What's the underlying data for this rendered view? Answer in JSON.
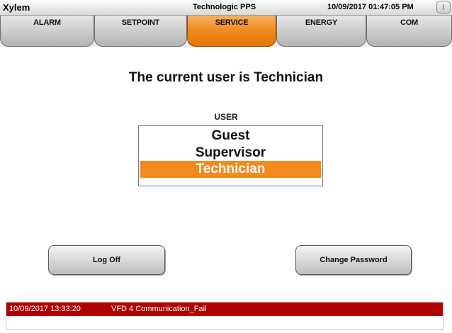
{
  "titlebar": {
    "app_name": "Xylem",
    "program": "Technologic PPS",
    "datetime": "10/09/2017 01:47:05 PM"
  },
  "tabs": [
    {
      "label": "ALARM"
    },
    {
      "label": "SETPOINT"
    },
    {
      "label": "SERVICE",
      "active": true
    },
    {
      "label": "ENERGY"
    },
    {
      "label": "COM"
    }
  ],
  "main": {
    "current_user_text": "The current user is Technician",
    "user_list_label": "USER",
    "users": [
      {
        "name": "Guest"
      },
      {
        "name": "Supervisor"
      },
      {
        "name": "Technician",
        "selected": true
      }
    ],
    "logoff_label": "Log Off",
    "change_password_label": "Change Password"
  },
  "alarm": {
    "timestamp": "10/09/2017 13:33:20",
    "message": "VFD 4 Communication_Fail"
  },
  "colors": {
    "active_tab": "#f08a1d",
    "selected_user": "#f38a1d",
    "alarm_banner": "#b00000"
  }
}
